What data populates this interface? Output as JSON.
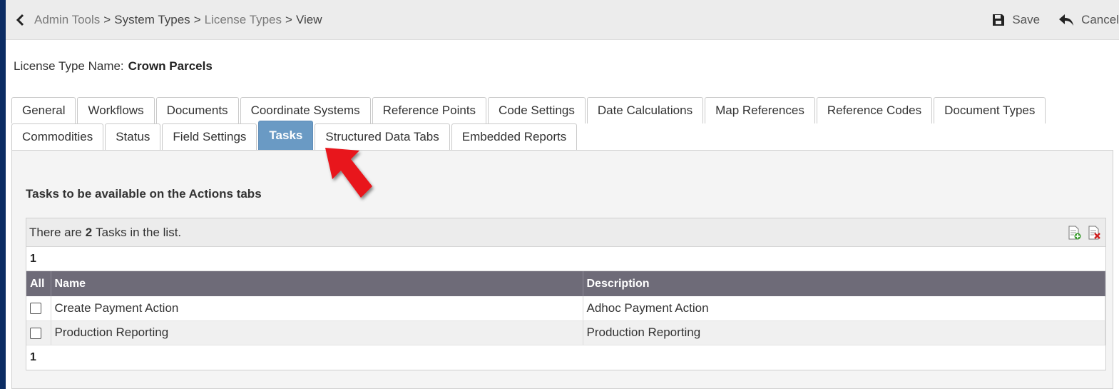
{
  "breadcrumb": {
    "items": [
      "Admin Tools",
      "System Types",
      "License Types",
      "View"
    ],
    "separator": ">"
  },
  "toolbar": {
    "save_label": "Save",
    "cancel_label": "Cancel"
  },
  "license": {
    "label": "License Type Name:",
    "value": "Crown Parcels"
  },
  "tabs": {
    "row1": [
      "General",
      "Workflows",
      "Documents",
      "Coordinate Systems",
      "Reference Points",
      "Code Settings",
      "Date Calculations",
      "Map References",
      "Reference Codes",
      "Document Types"
    ],
    "row2": [
      "Commodities",
      "Status",
      "Field Settings",
      "Tasks",
      "Structured Data Tabs",
      "Embedded Reports"
    ],
    "active": "Tasks"
  },
  "section": {
    "title": "Tasks to be available on the Actions tabs"
  },
  "grid": {
    "summary_prefix": "There are",
    "count": "2",
    "summary_suffix": "Tasks in the list.",
    "page_top": "1",
    "page_bottom": "1",
    "columns": [
      "All",
      "Name",
      "Description"
    ],
    "rows": [
      {
        "name": "Create Payment Action",
        "description": "Adhoc Payment Action",
        "checked": false
      },
      {
        "name": "Production Reporting",
        "description": "Production Reporting",
        "checked": false
      }
    ]
  },
  "colors": {
    "active_tab": "#6a9ac4",
    "table_header": "#6e6b78",
    "annotation_arrow": "#e8141b",
    "page_border": "#0b2c63"
  },
  "icons": [
    "chevron-left-icon",
    "save-icon",
    "undo-arrow-icon",
    "add-row-icon",
    "delete-row-icon",
    "annotation-arrow"
  ]
}
